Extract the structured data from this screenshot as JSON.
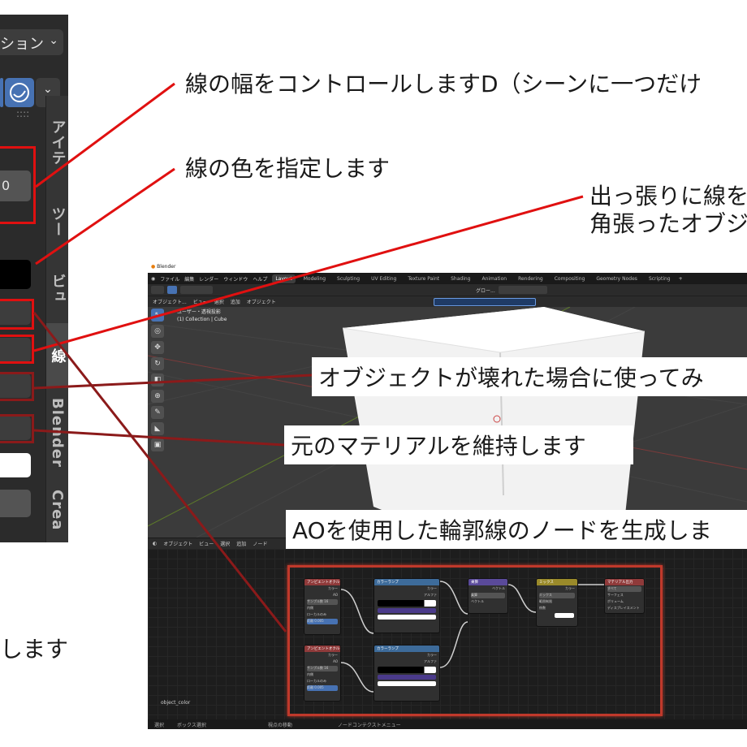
{
  "side_panel": {
    "dropdown_label": "ション",
    "field_value": "0",
    "tabs": [
      "アイテ",
      "ツー",
      "ビュ",
      "線",
      "Blender",
      "Crea"
    ]
  },
  "blender": {
    "window_title": "Blender",
    "menu": [
      "ファイル",
      "編集",
      "レンダー",
      "ウィンドウ",
      "ヘルプ"
    ],
    "workspaces": [
      "Layout",
      "Modeling",
      "Sculpting",
      "UV Editing",
      "Texture Paint",
      "Shading",
      "Animation",
      "Rendering",
      "Compositing",
      "Geometry Nodes",
      "Scripting"
    ],
    "active_workspace": "Layout",
    "transform_orientation": "グロー...",
    "viewport_header": [
      "オブジェクト...",
      "ビュー",
      "選択",
      "追加",
      "オブジェクト"
    ],
    "view_name": "ユーザー・透視投影",
    "collection_info": "(1) Collection | Cube",
    "node_editor_header": [
      "オブジェクト",
      "ビュー",
      "選択",
      "追加",
      "ノード"
    ],
    "node_tree_name": "object_color",
    "nodes": [
      {
        "title": "アンビエントオクルージョン",
        "rows": [
          "カラー",
          "AO",
          "サンプル数 16",
          "内側",
          "ローカルのみ",
          "カラー",
          "距離 0.005",
          "ノーマル"
        ],
        "color": "#8f3a3a"
      },
      {
        "title": "カラーランプ",
        "rows": [
          "カラー",
          "アルファ",
          "係数"
        ],
        "color": "#3d6b9a"
      },
      {
        "title": "乗算",
        "rows": [
          "ベクトル",
          "乗算",
          "ベクトル",
          "ベクトル"
        ],
        "color": "#5a4a9a"
      },
      {
        "title": "ミックス",
        "rows": [
          "カラー",
          "ミックス",
          "範囲制限",
          "係数",
          "A",
          "B"
        ],
        "color": "#9a8a2a"
      },
      {
        "title": "マテリアル出力",
        "rows": [
          "すべて",
          "サーフェス",
          "ボリューム",
          "ディスプレイスメント"
        ],
        "color": "#8f3a3a"
      },
      {
        "title": "アンビエントオクルージョン",
        "rows": [
          "カラー",
          "AO",
          "サンプル数 16",
          "内側",
          "ローカルのみ",
          "カラー",
          "距離 0.005",
          "ノーマル"
        ],
        "color": "#8f3a3a"
      },
      {
        "title": "カラーランプ",
        "rows": [
          "カラー",
          "アルファ",
          "係数"
        ],
        "color": "#3d6b9a"
      }
    ],
    "status_bar": [
      "選択",
      "ボックス選択",
      "視点の移動",
      "ノードコンテクストメニュー"
    ]
  },
  "annotations": {
    "line_width": "線の幅をコントロールしますD（シーンに一つだけ",
    "line_color": "線の色を指定します",
    "corner_line": "出っ張りに線を",
    "corner_line_2": "角張ったオブジ",
    "broken_object": "オブジェクトが壊れた場合に使ってみ",
    "keep_material": "元のマテリアルを維持します",
    "ao_nodes": "AOを使用した輪郭線のノードを生成しま",
    "partial_left": "します"
  },
  "colors": {
    "callout": "#e01010",
    "callout_dark": "#8b1a1a",
    "node_frame": "#c0392b"
  }
}
